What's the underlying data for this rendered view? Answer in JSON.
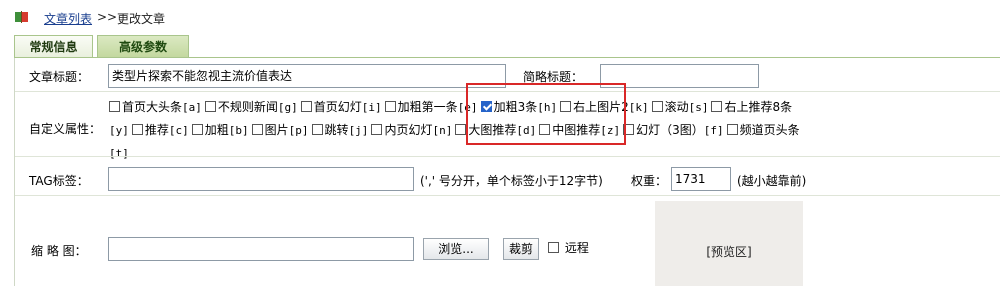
{
  "breadcrumb": {
    "link": "文章列表",
    "separator": ">>",
    "current": "更改文章"
  },
  "tabs": [
    {
      "label": "常规信息"
    },
    {
      "label": "高级参数"
    }
  ],
  "title_row": {
    "label": "文章标题：",
    "value": "类型片探索不能忽视主流价值表达",
    "short_label": "简略标题：",
    "short_value": ""
  },
  "attributes": {
    "label": "自定义属性：",
    "items": [
      {
        "text": "首页大头条",
        "code": "[a]",
        "checked": false
      },
      {
        "text": "不规则新闻",
        "code": "[g]",
        "checked": false
      },
      {
        "text": "首页幻灯",
        "code": "[i]",
        "checked": false
      },
      {
        "text": "加粗第一条",
        "code": "[e]",
        "checked": false
      },
      {
        "text": "加粗3条",
        "code": "[h]",
        "checked": true
      },
      {
        "text": "右上图片2",
        "code": "[k]",
        "checked": false
      },
      {
        "text": "滚动",
        "code": "[s]",
        "checked": false
      },
      {
        "text": "右上推荐8条",
        "code": "[y]",
        "checked": false
      },
      {
        "text": "推荐",
        "code": "[c]",
        "checked": false
      },
      {
        "text": "加粗",
        "code": "[b]",
        "checked": false
      },
      {
        "text": "图片",
        "code": "[p]",
        "checked": false
      },
      {
        "text": "跳转",
        "code": "[j]",
        "checked": false
      },
      {
        "text": "内页幻灯",
        "code": "[n]",
        "checked": false
      },
      {
        "text": "大图推荐",
        "code": "[d]",
        "checked": false
      },
      {
        "text": "中图推荐",
        "code": "[z]",
        "checked": false
      },
      {
        "text": "幻灯（3图）",
        "code": "[f]",
        "checked": false
      },
      {
        "text": "频道页头条",
        "code": "[t]",
        "checked": false
      }
    ]
  },
  "tag_row": {
    "label": "TAG标签：",
    "value": "",
    "hint": "(',' 号分开，单个标签小于12字节)",
    "weight_label": "权重：",
    "weight_value": "1731",
    "weight_hint": "(越小越靠前)"
  },
  "thumb_row": {
    "label": "缩 略 图：",
    "value": "",
    "browse_button": "浏览...",
    "crop_button": "裁剪",
    "remote_label": "远程",
    "remote_checked": false,
    "preview_label": "[预览区]"
  },
  "highlight_color": "#d92828",
  "checkbox_color": "#2563c9",
  "tab_border_color": "#a9c58c"
}
